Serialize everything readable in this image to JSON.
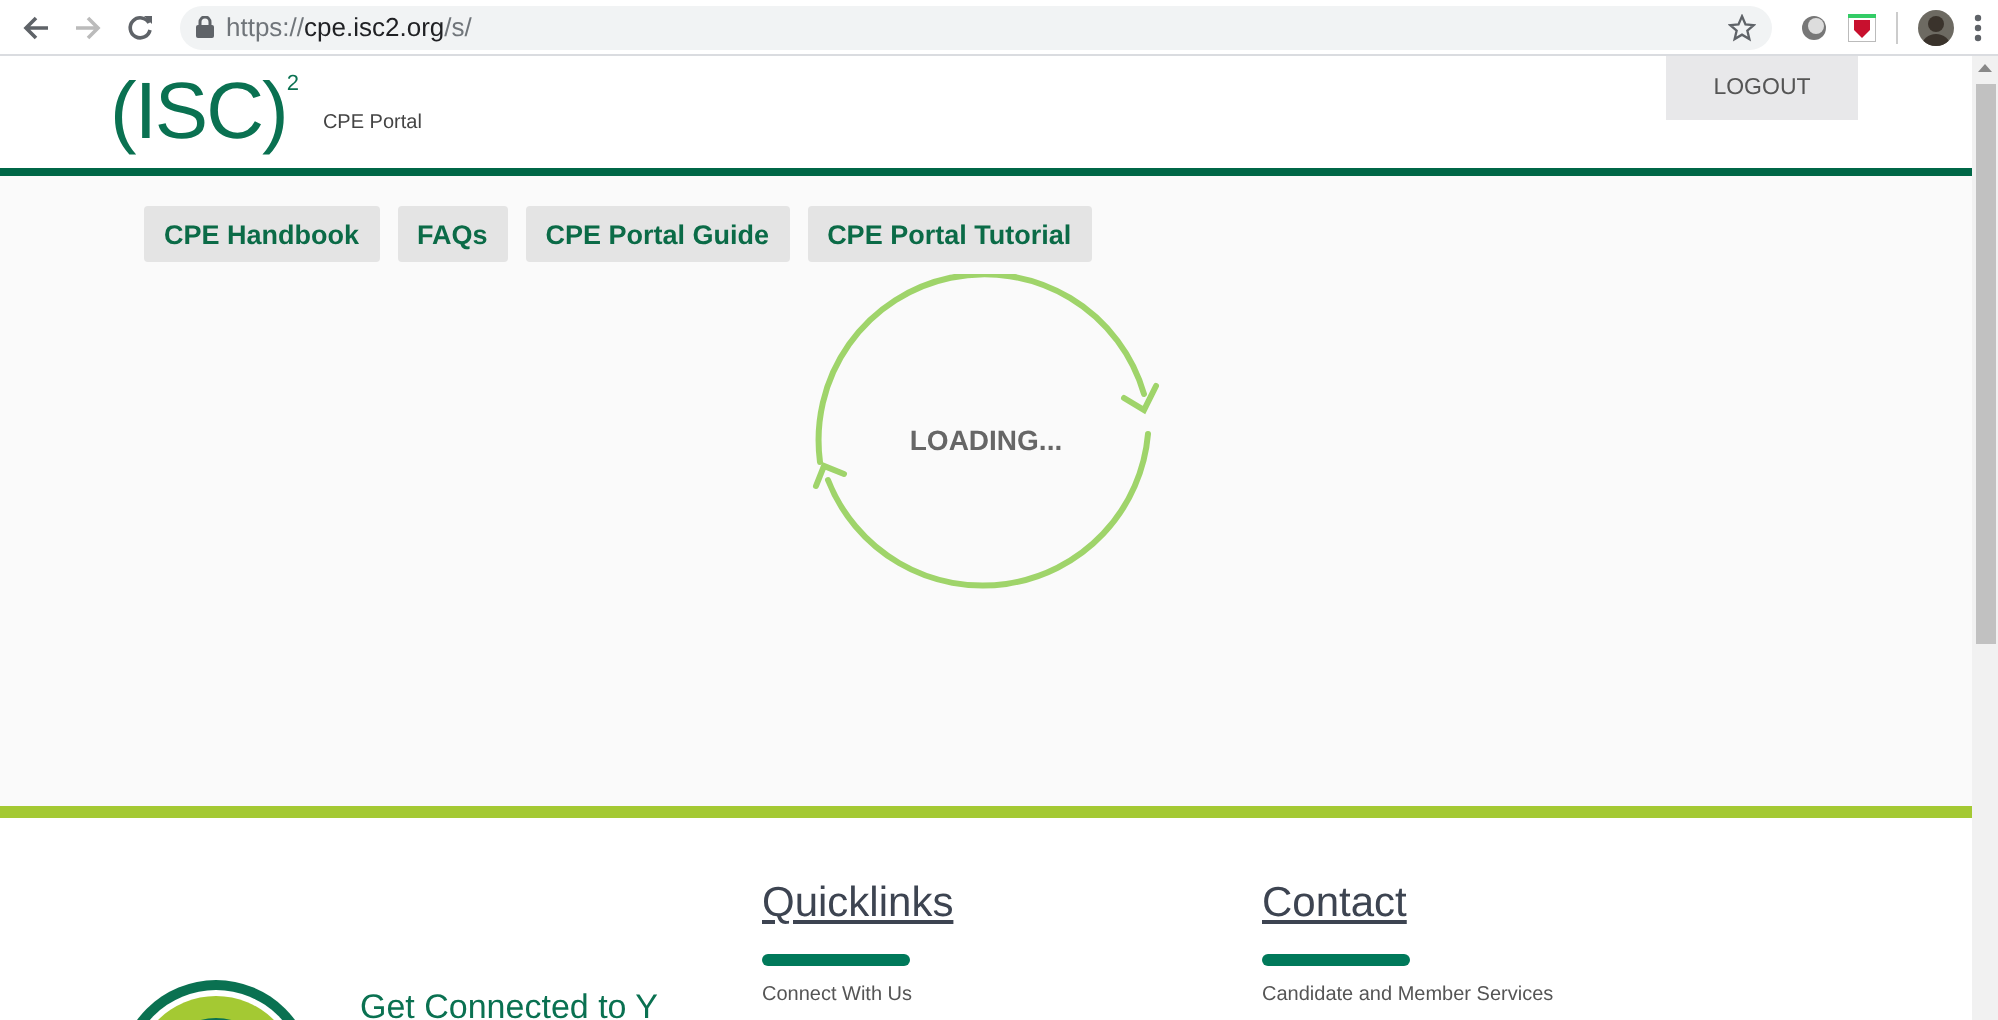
{
  "browser": {
    "url": {
      "scheme": "https://",
      "host": "cpe.isc2.org",
      "path": "/s/"
    },
    "back_disabled": false,
    "forward_disabled": true
  },
  "header": {
    "logo": {
      "text": "(ISC)",
      "sup": "2"
    },
    "portal_name": "CPE Portal",
    "logout": "LOGOUT"
  },
  "nav_buttons": [
    {
      "label": "CPE Handbook"
    },
    {
      "label": "FAQs"
    },
    {
      "label": "CPE Portal Guide"
    },
    {
      "label": "CPE Portal Tutorial"
    }
  ],
  "loading": {
    "text": "LOADING..."
  },
  "footer": {
    "tagline": "Get Connected to Y",
    "columns": [
      {
        "heading": "Quicklinks",
        "links": [
          "Connect With Us"
        ]
      },
      {
        "heading": "Contact",
        "links": [
          "Candidate and Member Services"
        ]
      }
    ]
  }
}
